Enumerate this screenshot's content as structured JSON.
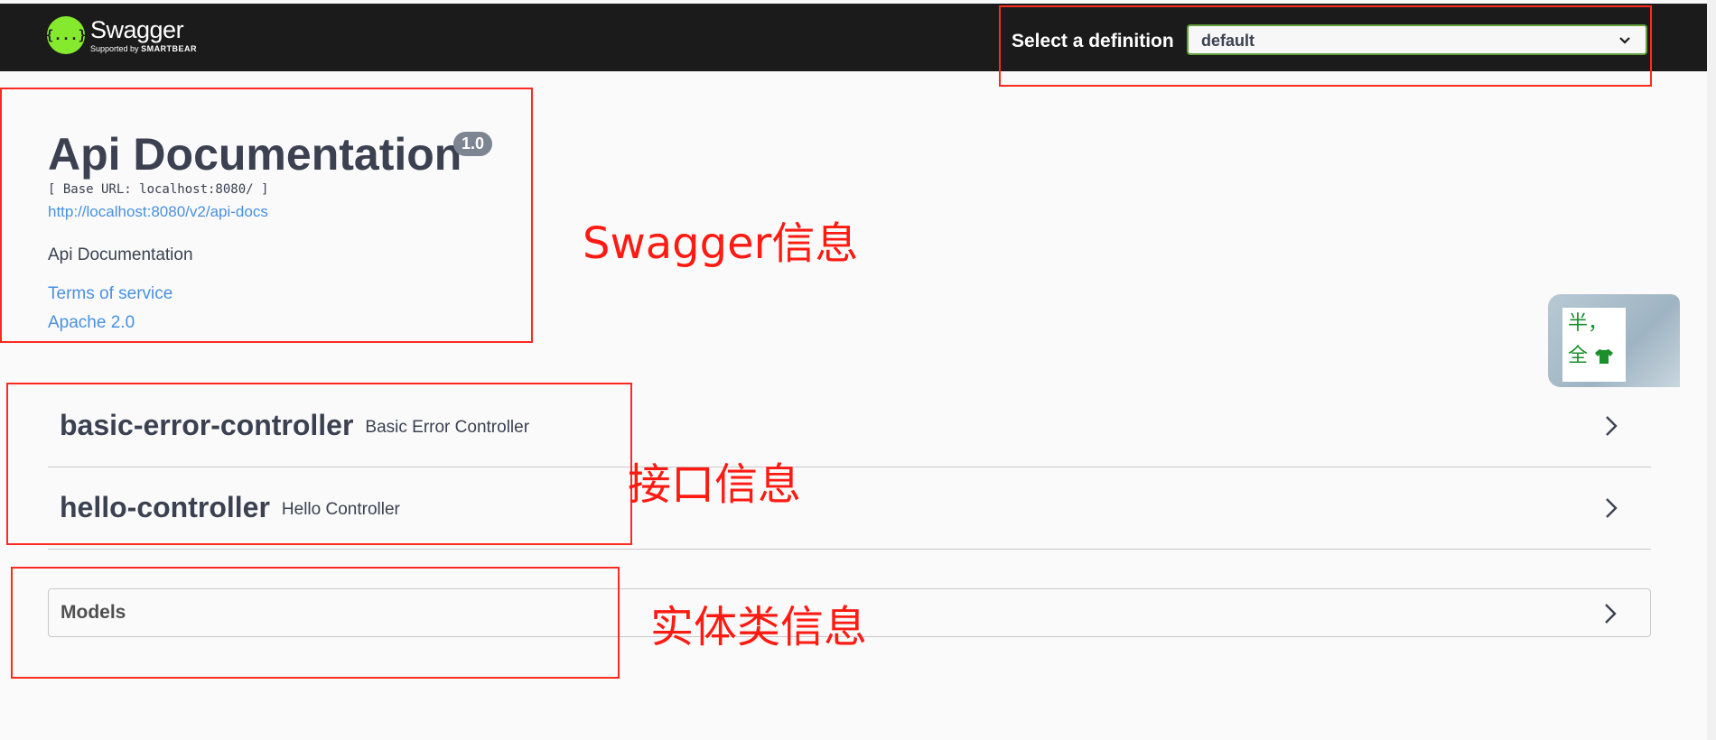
{
  "topbar": {
    "logo_symbol": "{...}",
    "logo_title": "Swagger",
    "logo_supported_by": "Supported by",
    "logo_brand": "SMARTBEAR",
    "definition_label": "Select a definition",
    "definition_selected": "default"
  },
  "info": {
    "title": "Api Documentation",
    "version": "1.0",
    "base_url": "[ Base URL: localhost:8080/ ]",
    "api_docs_url": "http://localhost:8080/v2/api-docs",
    "description": "Api Documentation",
    "terms": "Terms of service",
    "license": "Apache 2.0"
  },
  "controllers": [
    {
      "name": "basic-error-controller",
      "description": "Basic Error Controller"
    },
    {
      "name": "hello-controller",
      "description": "Hello Controller"
    }
  ],
  "models": {
    "label": "Models"
  },
  "annotations": {
    "swagger_info": "Swagger信息",
    "api_info": "接口信息",
    "entity_info": "实体类信息"
  },
  "widget": {
    "line1": "半，",
    "line2": "全"
  },
  "colors": {
    "topbar_bg": "#1b1b1b",
    "logo_green": "#85ea2d",
    "link_blue": "#4990e2",
    "annotation_red": "#ff1a12",
    "select_border": "#62a03f"
  }
}
